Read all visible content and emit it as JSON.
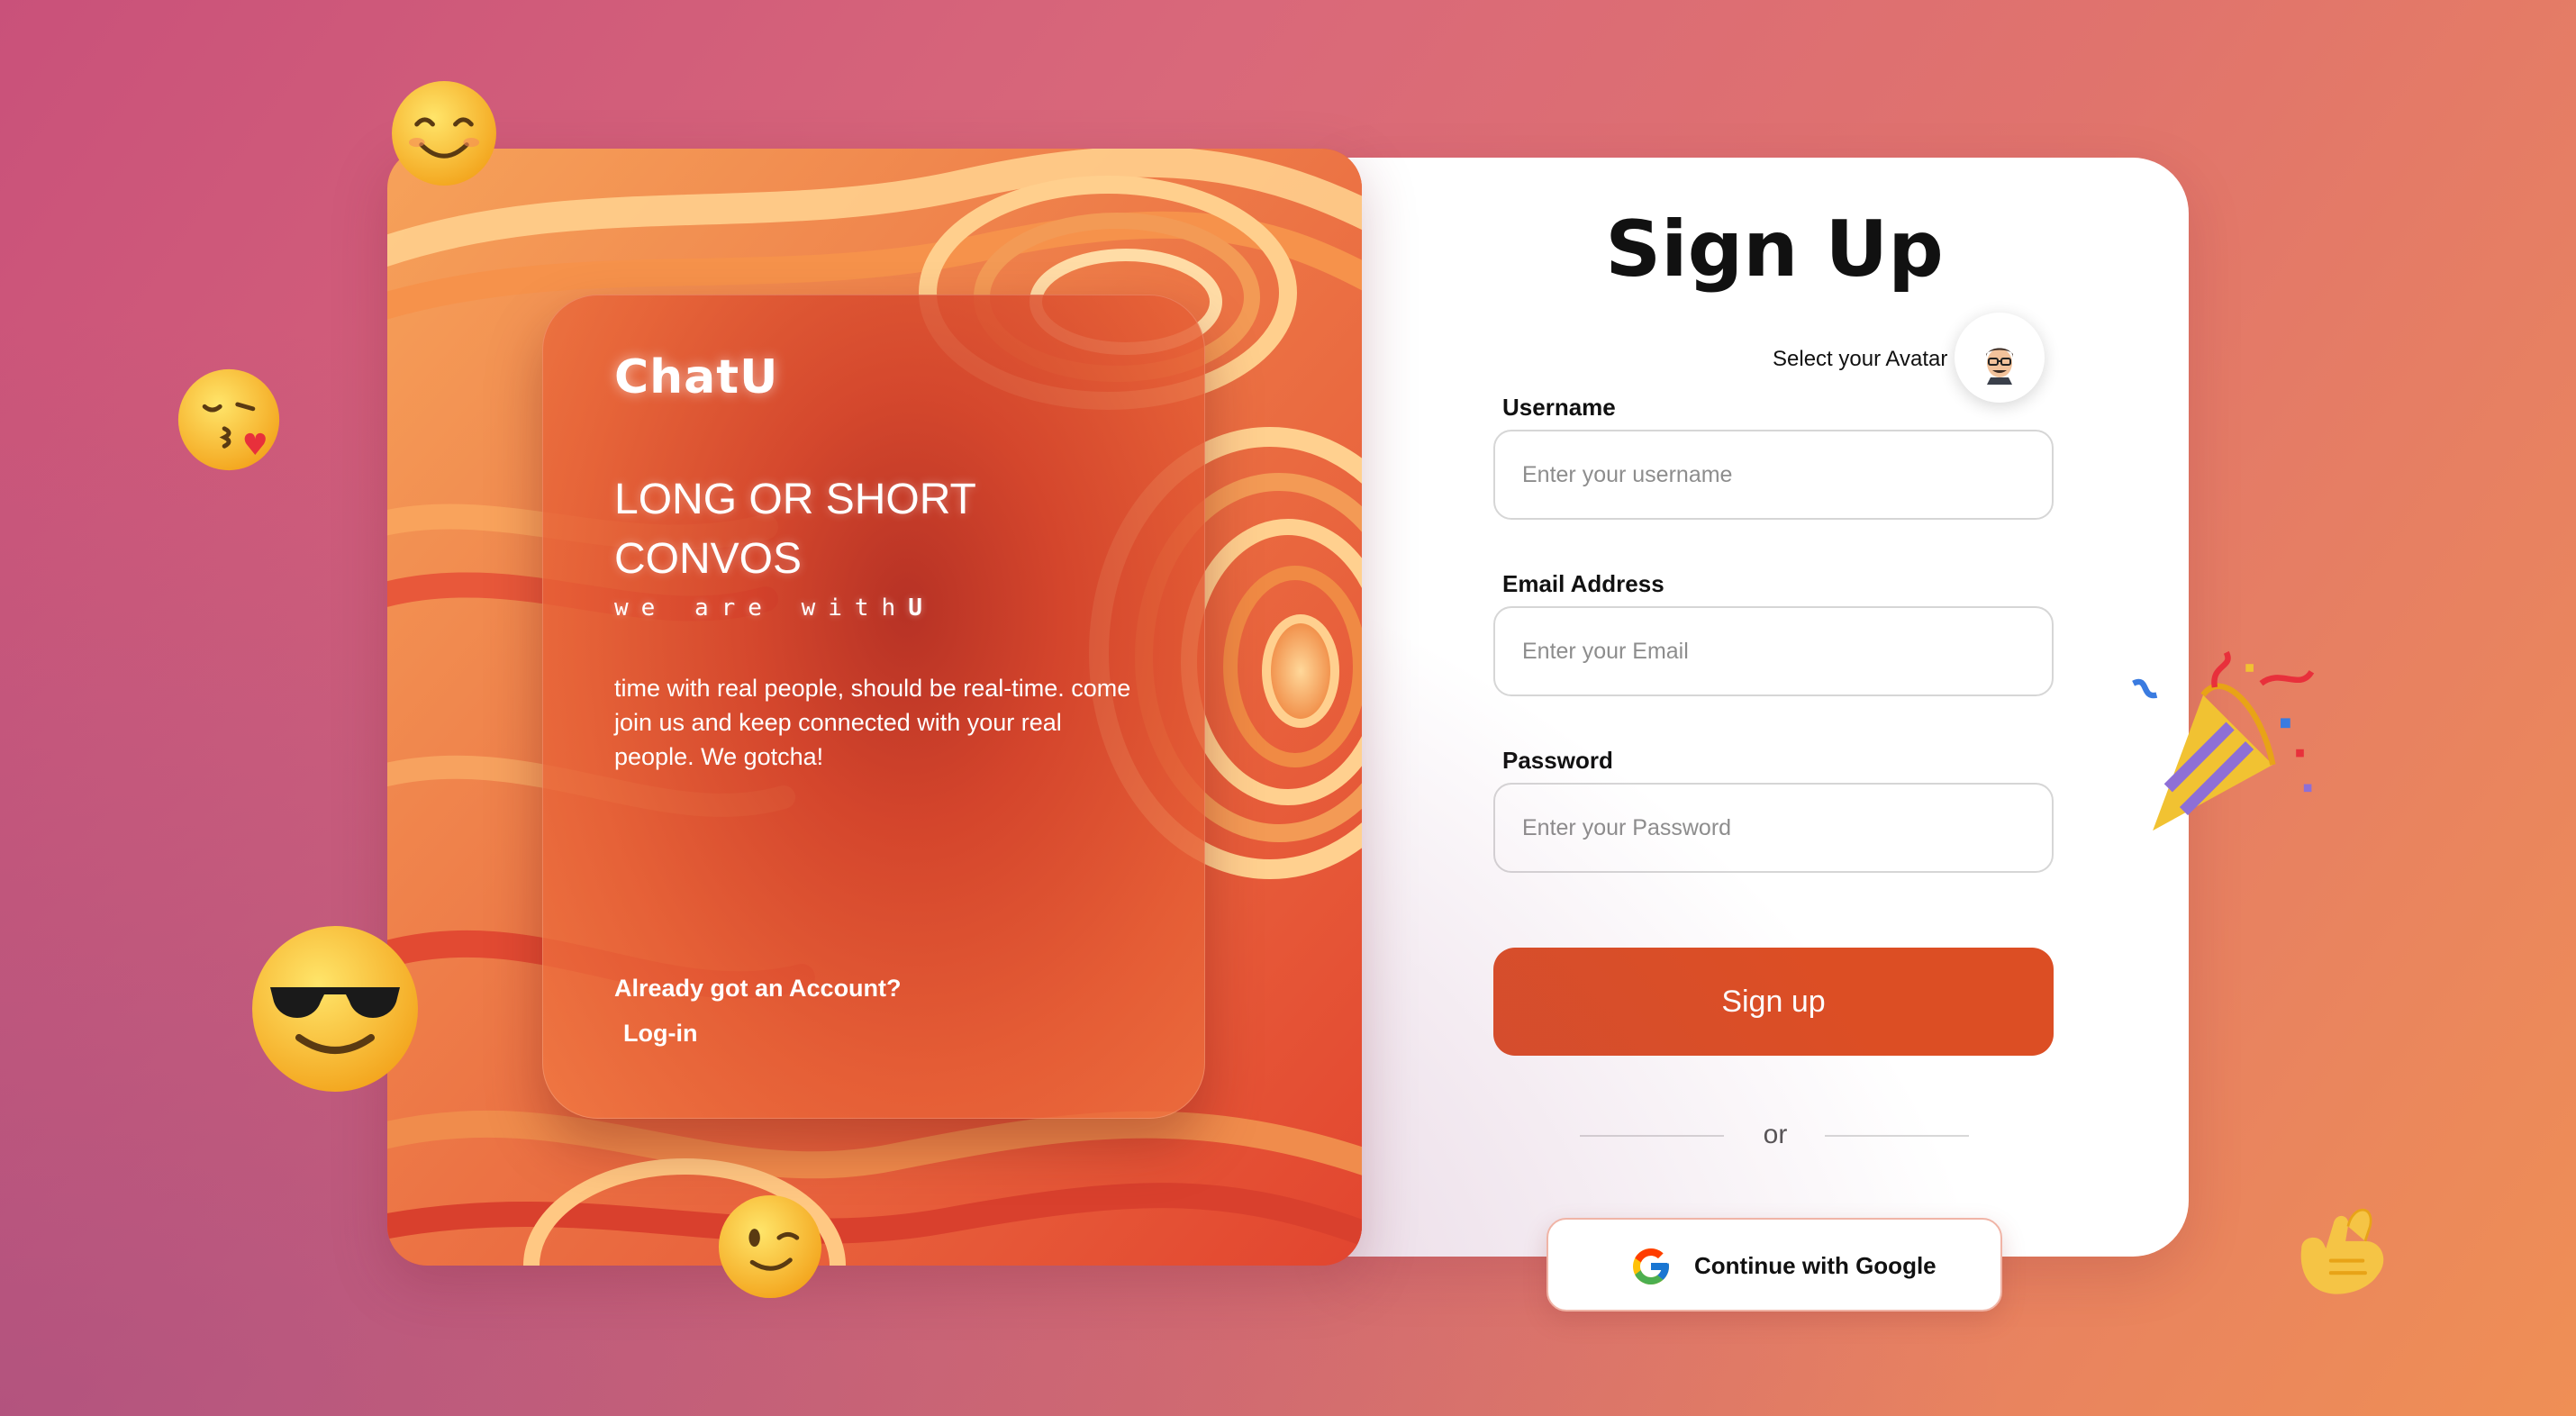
{
  "left_panel": {
    "brand": "ChatU",
    "headline": "LONG OR SHORT CONVOS",
    "tagline_prefix": "we are with",
    "tagline_emphasis": "U",
    "blurb": "time with real people, should be real-time. come join us and keep connected with your real people. We gotcha!",
    "account_question": "Already got an Account?",
    "login_link": "Log-in"
  },
  "form": {
    "title": "Sign Up",
    "avatar_label": "Select your Avatar",
    "avatar_icon": "memoji-avatar-icon",
    "username_label": "Username",
    "username_placeholder": "Enter your username",
    "username_value": "",
    "email_label": "Email Address",
    "email_placeholder": "Enter your Email",
    "email_value": "",
    "password_label": "Password",
    "password_placeholder": "Enter your Password",
    "password_value": "",
    "signup_label": "Sign up",
    "or_text": "or",
    "google_label": "Continue with Google",
    "google_icon": "google-g-icon"
  },
  "decorations": [
    "smiling-emoji",
    "kissing-heart-emoji",
    "sunglasses-emoji",
    "winking-emoji",
    "party-popper-emoji",
    "call-me-hand-emoji"
  ],
  "colors": {
    "accent": "#dc4e24",
    "background_start": "#c9517a",
    "background_end": "#ef8f55",
    "card_text": "#ffffff"
  }
}
